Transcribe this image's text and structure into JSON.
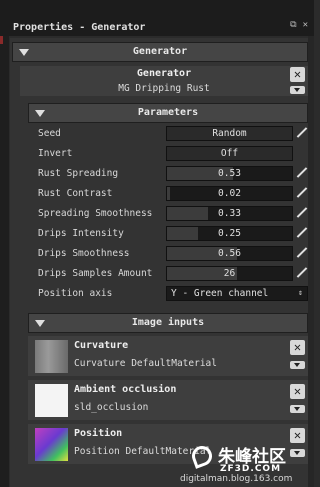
{
  "window": {
    "title": "Properties - Generator"
  },
  "generator_section": {
    "label": "Generator"
  },
  "generator_card": {
    "title": "Generator",
    "subtitle": "MG Dripping Rust"
  },
  "parameters_section": {
    "label": "Parameters"
  },
  "parameters": [
    {
      "label": "Seed",
      "value": "Random",
      "type": "button"
    },
    {
      "label": "Invert",
      "value": "Off",
      "type": "button"
    },
    {
      "label": "Rust Spreading",
      "value": "0.53",
      "fill": 0.53,
      "type": "slider"
    },
    {
      "label": "Rust Contrast",
      "value": "0.02",
      "fill": 0.02,
      "type": "slider"
    },
    {
      "label": "Spreading Smoothness",
      "value": "0.33",
      "fill": 0.33,
      "type": "slider"
    },
    {
      "label": "Drips Intensity",
      "value": "0.25",
      "fill": 0.25,
      "type": "slider"
    },
    {
      "label": "Drips Smoothness",
      "value": "0.56",
      "fill": 0.56,
      "type": "slider"
    },
    {
      "label": "Drips Samples Amount",
      "value": "26",
      "fill": 0.56,
      "type": "slider"
    },
    {
      "label": "Position axis",
      "value": "Y - Green channel",
      "type": "select"
    }
  ],
  "image_inputs_section": {
    "label": "Image inputs"
  },
  "image_inputs": [
    {
      "name": "Curvature",
      "source": "Curvature DefaultMaterial"
    },
    {
      "name": "Ambient occlusion",
      "source": "sld_occlusion"
    },
    {
      "name": "Position",
      "source": "Position DefaultMaterial"
    }
  ],
  "watermark": {
    "site": "digitalman.blog.163.com",
    "brand": "朱峰社区",
    "brand_url": "ZF3D.COM"
  },
  "colors": {
    "panel_bg": "#333333",
    "header_bg": "#454545",
    "field_bg": "#1a1a1a"
  }
}
